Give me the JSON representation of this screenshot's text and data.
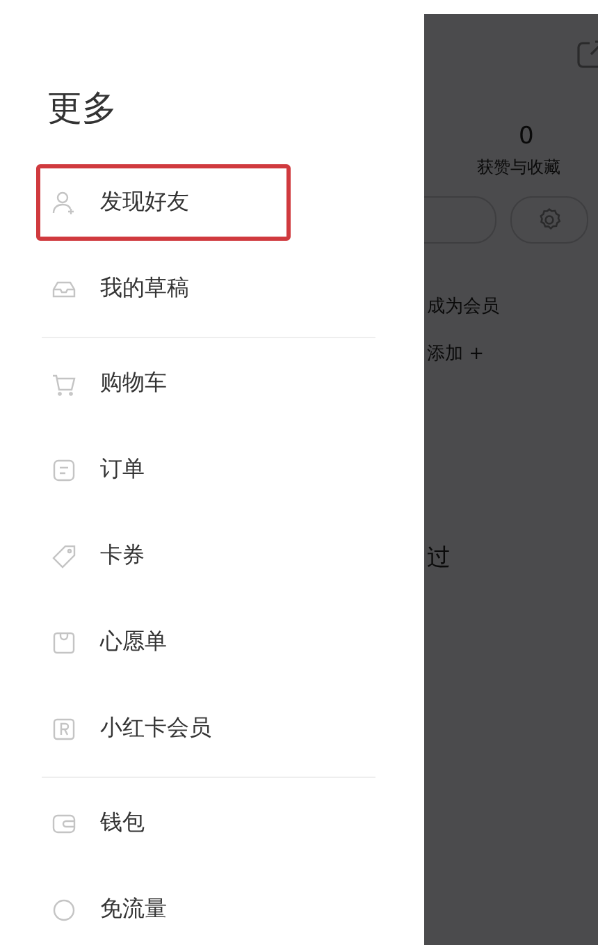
{
  "drawer": {
    "title": "更多",
    "groups": [
      {
        "items": [
          {
            "label": "发现好友",
            "kind": "person-add",
            "highlighted": true
          },
          {
            "label": "我的草稿",
            "kind": "inbox",
            "highlighted": false
          }
        ]
      },
      {
        "items": [
          {
            "label": "购物车",
            "kind": "cart",
            "highlighted": false
          },
          {
            "label": "订单",
            "kind": "order",
            "highlighted": false
          },
          {
            "label": "卡券",
            "kind": "tag",
            "highlighted": false
          },
          {
            "label": "心愿单",
            "kind": "bag",
            "highlighted": false
          },
          {
            "label": "小红卡会员",
            "kind": "card-r",
            "highlighted": false
          }
        ]
      },
      {
        "items": [
          {
            "label": "钱包",
            "kind": "wallet",
            "highlighted": false
          },
          {
            "label": "免流量",
            "kind": "circle",
            "highlighted": false
          }
        ]
      }
    ]
  },
  "background_page": {
    "likes_count": "0",
    "likes_label": "获赞与收藏",
    "member_link": "成为会员",
    "add_link": "添加 +",
    "fragment": "过"
  }
}
